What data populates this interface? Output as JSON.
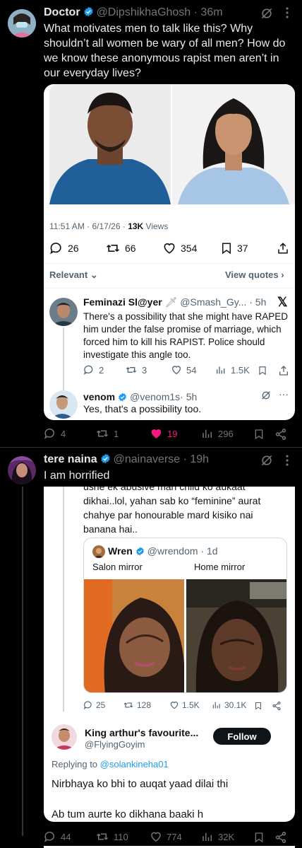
{
  "post1": {
    "author": "Doctor",
    "handle": "@DipshikhaGhosh",
    "time": "· 36m",
    "text": "What motivates men to talk like this? Why shouldn’t all women be wary of all men? How do we know these anonymous rapist men aren’t in our everyday lives?",
    "actions": {
      "replies": "4",
      "reposts": "1",
      "likes": "19",
      "views": "296"
    },
    "like_color": "#f91880"
  },
  "card1": {
    "meta_time": "11:51 AM · 6/17/26 ·",
    "meta_views": "13K",
    "meta_views_label": "Views",
    "stats": {
      "replies": "26",
      "reposts": "66",
      "likes": "354",
      "bookmarks": "37"
    },
    "filter": "Relevant",
    "view_quotes": "View quotes",
    "reply1": {
      "author": "Feminazi Sl@yer",
      "handle": "@Smash_Gy...",
      "time": "· 5h",
      "text": "There's a possibility that she might have RAPED him under the false promise of marriage, which forced him to kill his RAPIST. Police should investigate this angle too.",
      "replies": "2",
      "reposts": "3",
      "likes": "54",
      "views": "1.5K"
    },
    "reply2": {
      "author": "venom",
      "handle": "@venom1s",
      "time": "· 5h",
      "text": "Yes, that's a possibility too."
    }
  },
  "post2": {
    "author": "tere naina",
    "handle": "@nainaverse",
    "time": "· 19h",
    "text": "I am horrified",
    "actions": {
      "replies": "44",
      "reposts": "110",
      "likes": "774",
      "views": "32K"
    }
  },
  "card2": {
    "top_text_1": "ushe ek abusive man child ko aukaat",
    "top_text_2": "dikhai..lol, yahan sab ko “feminine” aurat chahye par honourable mard kisiko nai banana hai..",
    "quote": {
      "author": "Wren",
      "handle": "@wrendom",
      "time": "· 1d",
      "left_caption": "Salon mirror",
      "right_caption": "Home mirror"
    },
    "stats": {
      "replies": "25",
      "reposts": "128",
      "likes": "1.5K",
      "views": "30.1K"
    },
    "reply": {
      "author": "King arthur's favourite...",
      "handle": "@FlyingGoyim",
      "follow": "Follow",
      "replying_prefix": "Replying to",
      "replying_to": "@solankineha01",
      "line1": "Nirbhaya ko bhi to auqat yaad dilai thi",
      "line2": "Ab tum aurte ko dikhana baaki h"
    }
  }
}
